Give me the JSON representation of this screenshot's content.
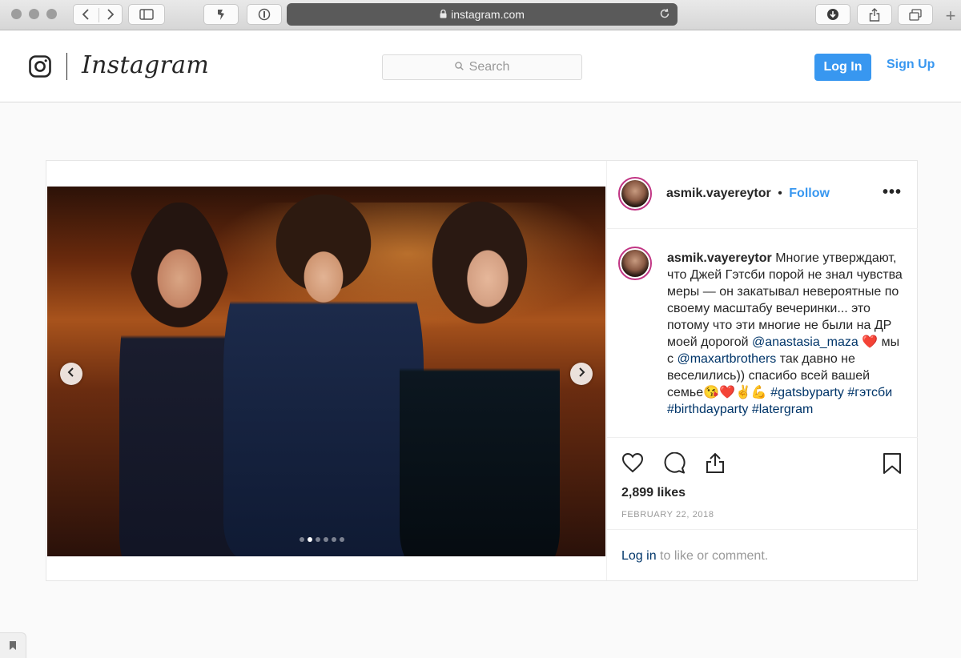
{
  "browser": {
    "url": "instagram.com",
    "icons": [
      "back-icon",
      "forward-icon",
      "sidebar-icon",
      "extension-icon",
      "password-icon",
      "lock-icon",
      "reload-icon",
      "download-icon",
      "share-icon",
      "tabs-icon",
      "new-tab-icon"
    ]
  },
  "header": {
    "brand": "Instagram",
    "search_placeholder": "Search",
    "login_label": "Log In",
    "signup_label": "Sign Up"
  },
  "post": {
    "username": "asmik.vayereytor",
    "follow_label": "Follow",
    "more_label": "•••",
    "caption_user": "asmik.vayereytor",
    "caption_part1": "Многие утверждают, что Джей Гэтсби порой не знал чувства меры — он закатывал невероятные по своему масштабу вечеринки... это потому что эти многие не были на ДР моей дорогой",
    "mention1": "@anastasia_maza",
    "caption_part2": "❤️ мы с",
    "mention2": "@maxartbrothers",
    "caption_part3": "так давно не веселились)) спасибо всей вашей семье😘❤️✌️💪",
    "hashtags": "#gatsbyparty #гэтсби #birthdayparty #latergram",
    "likes": "2,899 likes",
    "date": "FEBRUARY 22, 2018",
    "comment_login": "Log in",
    "comment_suffix": "to like or comment.",
    "carousel_count": 6,
    "carousel_active": 1
  },
  "colors": {
    "accent": "#3897f0",
    "link": "#003569",
    "text": "#262626",
    "muted": "#999999"
  }
}
